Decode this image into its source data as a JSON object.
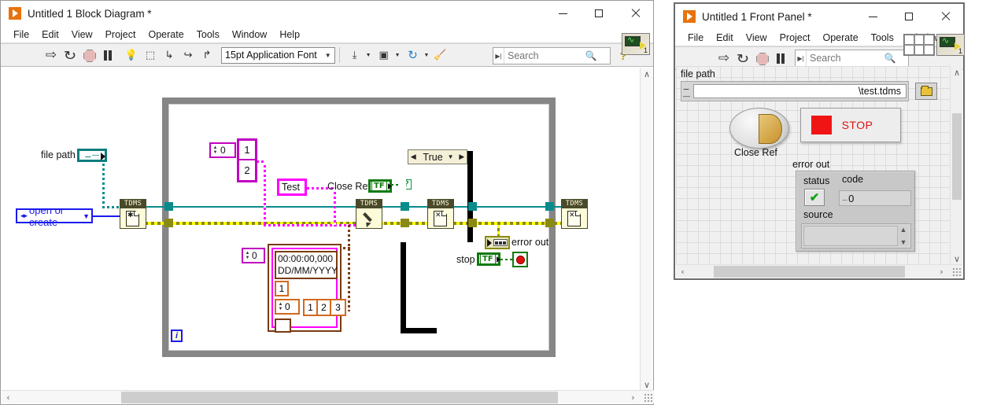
{
  "block_diagram": {
    "title": "Untitled 1 Block Diagram *",
    "app_icon": "labview-run-icon",
    "window_buttons": {
      "minimize": "minimize-icon",
      "maximize": "maximize-icon",
      "close": "close-icon"
    },
    "menus": [
      "File",
      "Edit",
      "View",
      "Project",
      "Operate",
      "Tools",
      "Window",
      "Help"
    ],
    "toolbar": {
      "run": "run-arrow-icon",
      "run_continuously": "run-continuously-icon",
      "abort": "abort-execution-icon",
      "pause": "pause-icon",
      "highlight": "highlight-execution-bulb-icon",
      "retain_values": "retain-wire-values-icon",
      "step_into": "step-into-icon",
      "step_over": "step-over-icon",
      "step_out": "step-out-icon",
      "font_selector": "15pt Application Font",
      "align": "align-objects-icon",
      "distribute": "distribute-objects-icon",
      "reorder": "reorder-icon",
      "clean_up": "clean-up-diagram-icon",
      "search_placeholder": "Search",
      "search_value": "",
      "search_icon": "magnifier-icon",
      "help": "context-help-icon",
      "connector_pane": "connector-pane-icon",
      "connector_number": "1"
    },
    "diagram": {
      "file_path_label": "file path",
      "file_path_terminal": "path-control-terminal",
      "operation_enum": "open or create",
      "tdms_open_node": "TDMS",
      "tdms_write_node": "TDMS",
      "tdms_close_node_case": "TDMS",
      "tdms_close_node_outer": "TDMS",
      "loop_count_const": "0",
      "array_const_values": [
        "1",
        "2"
      ],
      "string_const": "Test",
      "close_ref_label": "Close Ref",
      "close_ref_term": "TF",
      "case_selector": "True",
      "question_mark": "?",
      "timestamp_const_line1": "00:00:00,000",
      "timestamp_const_line2": "DD/MM/YYYY",
      "ts_index_const": "0",
      "ts_one": "1",
      "ts_num": "0",
      "ts_array": [
        "1",
        "2",
        "3"
      ],
      "error_out_label": "error out",
      "error_out_terminal": "error-cluster-indicator",
      "stop_label": "stop",
      "stop_term": "TF",
      "stop_const": "stop-boolean-constant",
      "iteration_terminal": "i"
    },
    "scrollbars": {
      "v_up": "∧",
      "v_down": "∨",
      "h_left": "‹",
      "h_right": "›"
    }
  },
  "front_panel": {
    "title": "Untitled 1 Front Panel *",
    "app_icon": "labview-run-icon",
    "window_buttons": {
      "minimize": "minimize-icon",
      "maximize": "maximize-icon",
      "close": "close-icon"
    },
    "menus": [
      "File",
      "Edit",
      "View",
      "Project",
      "Operate",
      "Tools",
      "Window"
    ],
    "toolbar": {
      "run": "run-arrow-icon",
      "run_continuously": "run-continuously-icon",
      "abort": "abort-execution-icon",
      "pause": "pause-icon",
      "search_placeholder": "Search",
      "search_value": "",
      "search_icon": "magnifier-icon",
      "grid_pane": "alignment-grid-icon",
      "connector_pane": "connector-pane-icon",
      "connector_number": "1"
    },
    "panel": {
      "file_path_label": "file path",
      "file_path_value": "\\test.tdms",
      "browse_button": "browse-folder-icon",
      "close_ref_label": "Close Ref",
      "close_ref_control": "close-ref-knob",
      "stop_button": "STOP",
      "error_out_label": "error out",
      "status_label": "status",
      "status_value": "no-error-check",
      "code_label": "code",
      "code_value": "0",
      "source_label": "source",
      "source_value": ""
    },
    "scrollbars": {
      "v_up": "∧",
      "v_down": "∨",
      "h_left": "‹",
      "h_right": "›"
    }
  },
  "colors": {
    "teal_wire": "#0a8c8c",
    "error_wire": "#8a8a12",
    "magenta_wire": "#ff00ff",
    "blue_terminal": "#1a1aee",
    "green_boolean": "#0f7a0f",
    "brown_timestamp": "#7a3b10",
    "orange_const": "#d2691e",
    "stop_red": "#e01010",
    "loop_gray": "#868686"
  }
}
